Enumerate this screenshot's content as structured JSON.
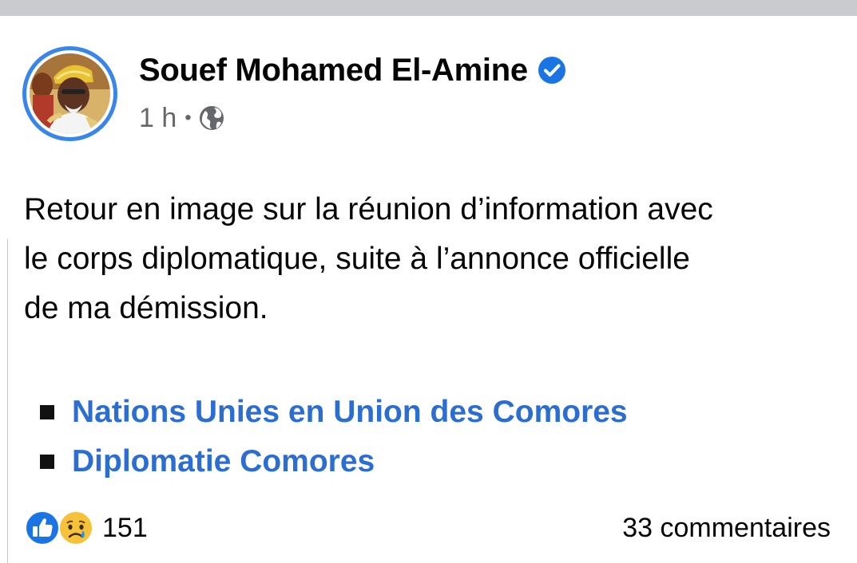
{
  "post": {
    "author": "Souef Mohamed El-Amine",
    "verified": true,
    "time": "1 h",
    "separator": "•",
    "audience_icon": "globe-icon",
    "text_lines": [
      "Retour en image sur la réunion d’information avec",
      "le corps diplomatique, suite à l’annonce officielle",
      "de ma démission."
    ],
    "tags": [
      "Nations Unies en Union des Comores",
      "Diplomatie Comores"
    ]
  },
  "footer": {
    "reaction_icons": [
      "like-icon",
      "sad-icon"
    ],
    "reaction_count": "151",
    "comments": "33 commentaires"
  },
  "colors": {
    "accent": "#3a86e8",
    "link": "#2c6ed0",
    "meta": "#65676b",
    "text": "#050505"
  }
}
